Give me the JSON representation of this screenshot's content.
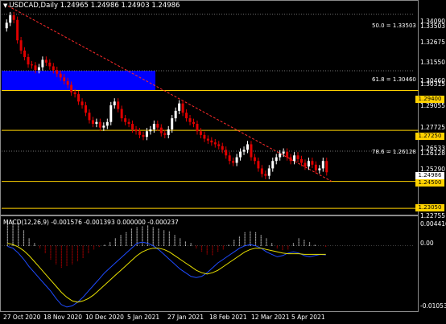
{
  "window": {
    "symbol_line": "USDCAD,Daily  1.24965 1.24986 1.24903 1.24986",
    "macd_line": "MACD(12,26,9) -0.001576 -0.001393 0.000000 -0.000237"
  },
  "price_axis": {
    "labels": [
      "1.34090",
      "1.33503",
      "1.32675",
      "1.31550",
      "1.30460",
      "1.30315",
      "1.29055",
      "1.27725",
      "1.26533",
      "1.26128",
      "1.25290",
      "1.24986",
      "1.24500",
      "1.23050",
      "1.22755"
    ]
  },
  "price_badges": {
    "b1": "1.29400",
    "b2": "1.27250",
    "b3": "1.24986",
    "b4": "1.24500",
    "b5": "1.23050"
  },
  "macd_axis": {
    "top": "0.004416",
    "zero": "0.00",
    "bottom": "-0.010533"
  },
  "fib_levels": {
    "f50": "50.0 = 1.33503",
    "f618": "61.8 = 1.30460",
    "f786": "78.6 = 1.26128"
  },
  "time_axis": [
    "27 Oct 2020",
    "18 Nov 2020",
    "10 Dec 2020",
    "5 Jan 2021",
    "27 Jan 2021",
    "18 Feb 2021",
    "12 Mar 2021",
    "5 Apr 2021"
  ],
  "colors": {
    "bull": "#ffffff",
    "bear": "#e00000",
    "zone": "#0000ff",
    "level": "#ffd200",
    "signal": "#e8e000",
    "macd_line": "#1e4bff",
    "trend": "#ff2a2a"
  },
  "chart_data": [
    {
      "type": "candlestick",
      "title": "USDCAD,Daily",
      "ylim": [
        1.2275,
        1.341
      ],
      "levels": [
        1.294,
        1.2725,
        1.245,
        1.2305
      ],
      "fib": [
        1.33503,
        1.3046,
        1.26128
      ],
      "closes": [
        1.3305,
        1.3345,
        1.332,
        1.321,
        1.3155,
        1.312,
        1.308,
        1.3075,
        1.305,
        1.3065,
        1.3105,
        1.309,
        1.307,
        1.305,
        1.303,
        1.301,
        1.299,
        1.297,
        1.293,
        1.292,
        1.288,
        1.286,
        1.282,
        1.278,
        1.276,
        1.277,
        1.274,
        1.275,
        1.277,
        1.286,
        1.288,
        1.284,
        1.279,
        1.277,
        1.276,
        1.273,
        1.272,
        1.27,
        1.269,
        1.272,
        1.273,
        1.276,
        1.274,
        1.271,
        1.27,
        1.273,
        1.279,
        1.283,
        1.287,
        1.282,
        1.279,
        1.277,
        1.276,
        1.272,
        1.27,
        1.268,
        1.267,
        1.266,
        1.265,
        1.264,
        1.262,
        1.259,
        1.256,
        1.255,
        1.258,
        1.261,
        1.262,
        1.265,
        1.258,
        1.256,
        1.252,
        1.249,
        1.248,
        1.252,
        1.256,
        1.258,
        1.26,
        1.261,
        1.258,
        1.256,
        1.259,
        1.257,
        1.255,
        1.253,
        1.256,
        1.254,
        1.251,
        1.252,
        1.256,
        1.2499
      ]
    },
    {
      "type": "bar",
      "title": "MACD(12,26,9)",
      "ylim": [
        -0.010533,
        0.004416
      ],
      "histogram": [
        0.004,
        0.0042,
        0.0038,
        0.0025,
        0.0012,
        0.0004,
        -0.0004,
        -0.0012,
        -0.0022,
        -0.003,
        -0.0036,
        -0.0034,
        -0.003,
        -0.0026,
        -0.002,
        -0.0012,
        -0.0006,
        -0.0002,
        0.0002,
        0.0006,
        0.0012,
        0.0018,
        0.0022,
        0.0028,
        0.003,
        0.0032,
        0.0034,
        0.003,
        0.0028,
        0.0026,
        0.0024,
        0.0018,
        0.0012,
        0.0008,
        0.0004,
        -0.0004,
        -0.001,
        -0.0014,
        -0.0016,
        -0.001,
        -0.0006,
        0.0002,
        0.001,
        0.0016,
        0.0022,
        0.0024,
        0.0022,
        0.0018,
        0.0012,
        0.0004,
        -0.0004,
        -0.0008,
        -0.0006,
        0.0004,
        0.0012,
        0.001,
        0.0006,
        0.0002,
        0.0,
        -0.0002
      ],
      "macd": [
        -0.0001,
        -0.0004,
        -0.0012,
        -0.0022,
        -0.0034,
        -0.0044,
        -0.0054,
        -0.0064,
        -0.0074,
        -0.0086,
        -0.0096,
        -0.01,
        -0.0098,
        -0.0092,
        -0.0084,
        -0.0074,
        -0.0064,
        -0.0054,
        -0.0044,
        -0.0036,
        -0.0028,
        -0.002,
        -0.0012,
        -0.0004,
        0.0004,
        0.0006,
        0.0004,
        0.0,
        -0.0006,
        -0.0014,
        -0.0022,
        -0.003,
        -0.0038,
        -0.0044,
        -0.005,
        -0.0052,
        -0.005,
        -0.0044,
        -0.0036,
        -0.0028,
        -0.0022,
        -0.0016,
        -0.001,
        -0.0004,
        0.0,
        0.0002,
        0.0,
        -0.0004,
        -0.001,
        -0.0014,
        -0.0018,
        -0.0016,
        -0.0012,
        -0.001,
        -0.0012,
        -0.0016,
        -0.0018,
        -0.0016,
        -0.0014,
        -0.0015
      ],
      "signal": [
        0.0004,
        0.0002,
        -0.0002,
        -0.0008,
        -0.0016,
        -0.0026,
        -0.0036,
        -0.0046,
        -0.0056,
        -0.0066,
        -0.0076,
        -0.0084,
        -0.009,
        -0.0092,
        -0.009,
        -0.0086,
        -0.008,
        -0.0072,
        -0.0064,
        -0.0056,
        -0.0048,
        -0.004,
        -0.0032,
        -0.0024,
        -0.0016,
        -0.001,
        -0.0006,
        -0.0004,
        -0.0004,
        -0.0006,
        -0.001,
        -0.0016,
        -0.0022,
        -0.0028,
        -0.0034,
        -0.004,
        -0.0044,
        -0.0046,
        -0.0044,
        -0.004,
        -0.0034,
        -0.0028,
        -0.0022,
        -0.0016,
        -0.001,
        -0.0006,
        -0.0004,
        -0.0004,
        -0.0006,
        -0.0008,
        -0.001,
        -0.0012,
        -0.0013,
        -0.0013,
        -0.0013,
        -0.0014,
        -0.0014,
        -0.0014,
        -0.0014,
        -0.0014
      ]
    }
  ]
}
